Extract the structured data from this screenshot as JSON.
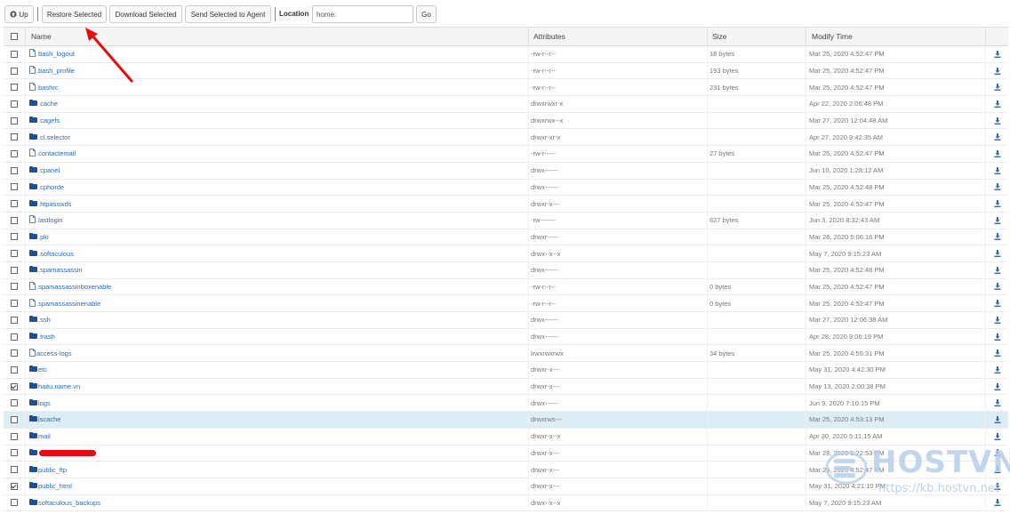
{
  "toolbar": {
    "up_label": "Up",
    "restore_label": "Restore Selected",
    "download_label": "Download Selected",
    "send_label": "Send Selected to Agent",
    "location_label": "Location",
    "location_value": "home:",
    "go_label": "Go"
  },
  "table": {
    "headers": {
      "name": "Name",
      "attributes": "Attributes",
      "size": "Size",
      "modify_time": "Modify Time"
    },
    "rows": [
      {
        "icon": "file-icon",
        "name": ".bash_logout",
        "attr": "-rw-r--r--",
        "size": "18 bytes",
        "time": "Mar 25, 2020 4:52:47 PM",
        "checked": false
      },
      {
        "icon": "file-icon",
        "name": ".bash_profile",
        "attr": "-rw-r--r--",
        "size": "193 bytes",
        "time": "Mar 25, 2020 4:52:47 PM",
        "checked": false
      },
      {
        "icon": "file-icon",
        "name": ".bashrc",
        "attr": "-rw-r--r--",
        "size": "231 bytes",
        "time": "Mar 25, 2020 4:52:47 PM",
        "checked": false
      },
      {
        "icon": "folder-icon",
        "name": ".cache",
        "attr": "drwxrwxr-x",
        "size": "",
        "time": "Apr 22, 2020 2:06:48 PM",
        "checked": false
      },
      {
        "icon": "folder-icon",
        "name": ".cagefs",
        "attr": "drwxrwx--x",
        "size": "",
        "time": "Mar 27, 2020 12:04:48 AM",
        "checked": false
      },
      {
        "icon": "folder-icon",
        "name": ".cl.selector",
        "attr": "drwxr-xr-x",
        "size": "",
        "time": "Apr 27, 2020 9:42:35 AM",
        "checked": false
      },
      {
        "icon": "file-icon",
        "name": ".contactemail",
        "attr": "-rw-r-----",
        "size": "27 bytes",
        "time": "Mar 25, 2020 4:52:47 PM",
        "checked": false
      },
      {
        "icon": "folder-icon",
        "name": ".cpanel",
        "attr": "drwx------",
        "size": "",
        "time": "Jun 10, 2020 1:28:12 AM",
        "checked": false
      },
      {
        "icon": "folder-icon",
        "name": ".cphorde",
        "attr": "drwx------",
        "size": "",
        "time": "Mar 25, 2020 4:52:48 PM",
        "checked": false
      },
      {
        "icon": "folder-icon",
        "name": ".htpasswds",
        "attr": "drwxr-x---",
        "size": "",
        "time": "Mar 25, 2020 4:52:47 PM",
        "checked": false
      },
      {
        "icon": "file-icon",
        "name": ".lastlogin",
        "attr": "-rw-------",
        "size": "627 bytes",
        "time": "Jun 3, 2020 8:32:43 AM",
        "checked": false
      },
      {
        "icon": "folder-icon",
        "name": ".pki",
        "attr": "drwxr-----",
        "size": "",
        "time": "Mar 28, 2020 5:06:16 PM",
        "checked": false
      },
      {
        "icon": "folder-icon",
        "name": ".softaculous",
        "attr": "drwx--x--x",
        "size": "",
        "time": "May 7, 2020 9:15:23 AM",
        "checked": false
      },
      {
        "icon": "folder-icon",
        "name": ".spamassassin",
        "attr": "drwx------",
        "size": "",
        "time": "Mar 25, 2020 4:52:48 PM",
        "checked": false
      },
      {
        "icon": "file-icon",
        "name": ".spamassassinboxenable",
        "attr": "-rw-r--r--",
        "size": "0 bytes",
        "time": "Mar 25, 2020 4:52:47 PM",
        "checked": false
      },
      {
        "icon": "file-icon",
        "name": ".spamassassinenable",
        "attr": "-rw-r--r--",
        "size": "0 bytes",
        "time": "Mar 25, 2020 4:52:47 PM",
        "checked": false
      },
      {
        "icon": "folder-icon",
        "name": ".ssh",
        "attr": "drwx------",
        "size": "",
        "time": "Mar 27, 2020 12:06:38 AM",
        "checked": false
      },
      {
        "icon": "folder-icon",
        "name": ".trash",
        "attr": "drwx------",
        "size": "",
        "time": "Apr 28, 2020 9:06:19 PM",
        "checked": false
      },
      {
        "icon": "file-icon",
        "name": "access-logs",
        "attr": "lrwxrwxrwx",
        "size": "34 bytes",
        "time": "Mar 25, 2020 4:55:31 PM",
        "checked": false
      },
      {
        "icon": "folder-icon",
        "name": "etc",
        "attr": "drwxr-x---",
        "size": "",
        "time": "May 31, 2020 4:42:30 PM",
        "checked": false
      },
      {
        "icon": "folder-icon",
        "name": "haitu.name.vn",
        "attr": "drwxr-x---",
        "size": "",
        "time": "May 13, 2020 2:00:38 PM",
        "checked": true
      },
      {
        "icon": "folder-icon",
        "name": "logs",
        "attr": "drwx------",
        "size": "",
        "time": "Jun 9, 2020 7:10:15 PM",
        "checked": false
      },
      {
        "icon": "folder-icon",
        "name": "lscache",
        "attr": "drwxrws---",
        "size": "",
        "time": "Mar 25, 2020 4:53:13 PM",
        "checked": false,
        "highlight": true
      },
      {
        "icon": "folder-icon",
        "name": "mail",
        "attr": "drwxr-x--x",
        "size": "",
        "time": "Apr 30, 2020 5:11:15 AM",
        "checked": false
      },
      {
        "icon": "folder-icon",
        "name": "",
        "attr": "drwxr-x---",
        "size": "",
        "time": "Mar 28, 2020 5:22:53 PM",
        "checked": false,
        "redacted": true
      },
      {
        "icon": "folder-icon",
        "name": "public_ftp",
        "attr": "drwxr-x---",
        "size": "",
        "time": "Mar 25, 2020 4:52:47 PM",
        "checked": false
      },
      {
        "icon": "folder-icon",
        "name": "public_html",
        "attr": "drwxr-x---",
        "size": "",
        "time": "May 31, 2020 4:21:10 PM",
        "checked": true
      },
      {
        "icon": "folder-icon",
        "name": "softaculous_backups",
        "attr": "drwx--x--x",
        "size": "",
        "time": "May 7, 2020 9:15:23 AM",
        "checked": false
      }
    ]
  },
  "watermark": {
    "brand": "HOSTVN",
    "url": "https://kb.hostvn.net"
  },
  "colors": {
    "link": "#2a6bb3",
    "folder": "#1f4f8f",
    "highlight_row": "#dcedf5",
    "arrow": "#e01010"
  }
}
